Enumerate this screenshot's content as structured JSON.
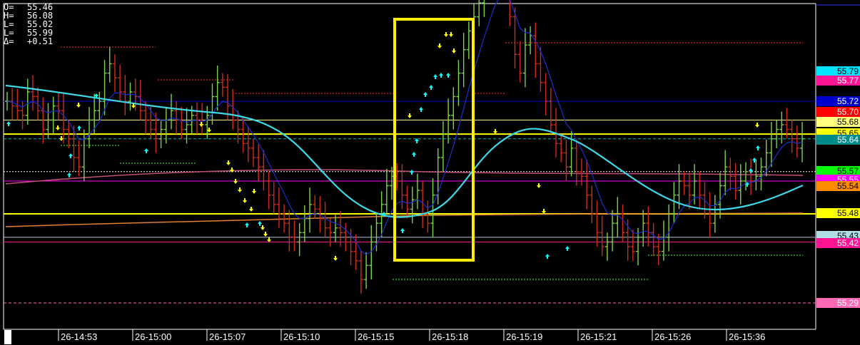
{
  "ohlc": [
    {
      "label": "O=",
      "value": "55.46"
    },
    {
      "label": "H=",
      "value": "56.08"
    },
    {
      "label": "L=",
      "value": "55.02"
    },
    {
      "label": "L=",
      "value": "55.99"
    },
    {
      "label": "Δ=",
      "value": "+0.51"
    }
  ],
  "chart_data": {
    "type": "line",
    "ylim": [
      55.2,
      56.12
    ],
    "x_ticks": [
      "26-14:53",
      "26-15:00",
      "26-15:07",
      "26-15:10",
      "26-15:15",
      "26-15:18",
      "26-15:19",
      "26-15:21",
      "26-15:26",
      "26-15:36"
    ],
    "close_series": [
      55.72,
      55.71,
      55.7,
      55.69,
      55.74,
      55.73,
      55.7,
      55.66,
      55.68,
      55.71,
      55.7,
      55.66,
      55.64,
      55.6,
      55.58,
      55.64,
      55.68,
      55.7,
      55.72,
      55.78,
      55.8,
      55.77,
      55.74,
      55.72,
      55.74,
      55.73,
      55.7,
      55.68,
      55.66,
      55.64,
      55.66,
      55.68,
      55.7,
      55.68,
      55.66,
      55.67,
      55.69,
      55.68,
      55.67,
      55.69,
      55.73,
      55.76,
      55.75,
      55.71,
      55.68,
      55.66,
      55.63,
      55.62,
      55.6,
      55.58,
      55.55,
      55.52,
      55.5,
      55.48,
      55.46,
      55.43,
      55.42,
      55.44,
      55.47,
      55.5,
      55.49,
      55.47,
      55.45,
      55.44,
      55.45,
      55.44,
      55.42,
      55.4,
      55.38,
      55.34,
      55.37,
      55.42,
      55.46,
      55.5,
      55.54,
      55.56,
      55.55,
      55.52,
      55.49,
      55.51,
      55.53,
      55.48,
      55.46,
      55.52,
      55.6,
      55.65,
      55.69,
      55.73,
      55.78,
      55.83,
      55.87,
      55.9,
      55.93,
      55.96,
      55.99,
      56.02,
      56.0,
      55.97,
      55.9,
      55.82,
      55.78,
      55.84,
      55.86,
      55.8,
      55.76,
      55.72,
      55.67,
      55.63,
      55.61,
      55.58,
      55.62,
      55.57,
      55.56,
      55.52,
      55.48,
      55.44,
      55.41,
      55.42,
      55.46,
      55.48,
      55.44,
      55.41,
      55.4,
      55.43,
      55.46,
      55.44,
      55.41,
      55.4,
      55.43,
      55.48,
      55.52,
      55.55,
      55.54,
      55.52,
      55.55,
      55.52,
      55.49,
      55.46,
      55.5,
      55.54,
      55.58,
      55.56,
      55.53,
      55.55,
      55.57,
      55.55,
      55.56,
      55.58,
      55.61,
      55.64,
      55.66,
      55.67,
      55.66,
      55.64,
      55.62,
      55.64
    ],
    "annotations": "Yellow rectangle highlighting 26-15:15 to 26-15:18 rally"
  },
  "price_labels": [
    {
      "text": "55.79",
      "bg": "#00e5ff",
      "fg": "#000000"
    },
    {
      "text": "55.77",
      "bg": "#ff1493",
      "fg": "#ffffff"
    },
    {
      "text": "55.72",
      "bg": "#0000cd",
      "fg": "#ffffff"
    },
    {
      "text": "55.70",
      "bg": "#ff0000",
      "fg": "#ffffff"
    },
    {
      "text": "55.68",
      "bg": "#ffff80",
      "fg": "#000000"
    },
    {
      "text": "55.65",
      "bg": "#ffff00",
      "fg": "#000000"
    },
    {
      "text": "55.64",
      "bg": "#008b8b",
      "fg": "#ffffff"
    },
    {
      "text": "55.57",
      "bg": "#00ff00",
      "fg": "#000000"
    },
    {
      "text": "55.55",
      "bg": "#ff00ff",
      "fg": "#ffffff"
    },
    {
      "text": "55.54",
      "bg": "#ff8c00",
      "fg": "#000000"
    },
    {
      "text": "55.48",
      "bg": "#ffff00",
      "fg": "#000000"
    },
    {
      "text": "55.43",
      "bg": "#b0e0e6",
      "fg": "#000000"
    },
    {
      "text": "55.42",
      "bg": "#ff1493",
      "fg": "#ffffff"
    },
    {
      "text": "55.29",
      "bg": "#ff69b4",
      "fg": "#ffffff"
    }
  ],
  "horizontal_levels": [
    {
      "value": 55.72,
      "color": "#0000cd",
      "style": "solid"
    },
    {
      "value": 55.68,
      "color": "#ffff80",
      "style": "solid"
    },
    {
      "value": 55.65,
      "color": "#ffff00",
      "style": "solid"
    },
    {
      "value": 55.64,
      "color": "#00bfbf",
      "style": "dashed"
    },
    {
      "value": 55.57,
      "color": "#ffffff",
      "style": "dotted"
    },
    {
      "value": 55.55,
      "color": "#ff00ff",
      "style": "solid"
    },
    {
      "value": 55.48,
      "color": "#ffff00",
      "style": "solid"
    },
    {
      "value": 55.43,
      "color": "#b0c4de",
      "style": "solid"
    },
    {
      "value": 55.42,
      "color": "#ff1493",
      "style": "solid"
    },
    {
      "value": 55.29,
      "color": "#ff69b4",
      "style": "dashed"
    }
  ],
  "colors": {
    "background": "#000000",
    "up_bar": "#7cd34c",
    "down_bar": "#d22a1a",
    "smooth_line": "#3fd8e8",
    "fast_line": "#1a2fcf",
    "highlight_box": "#ffee00",
    "arrow_up": "#00ffff",
    "arrow_down": "#ffff00"
  }
}
